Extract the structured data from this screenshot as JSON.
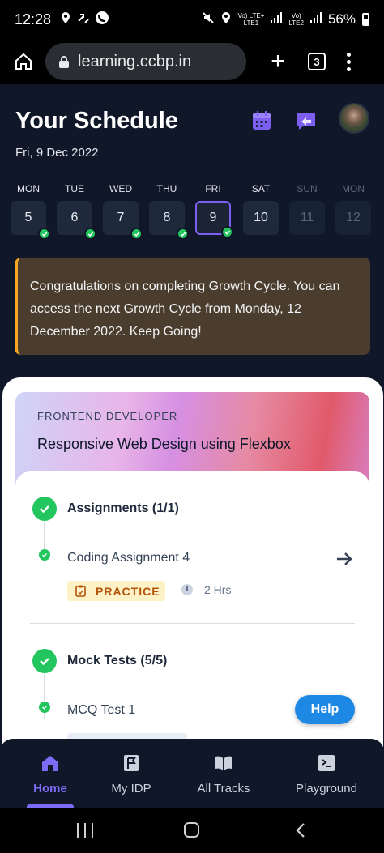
{
  "status_bar": {
    "time": "12:28",
    "net_label_1": "Vo) LTE+",
    "net_label_1b": "LTE1",
    "net_label_2": "Vo)",
    "net_label_2b": "LTE2",
    "battery": "56%"
  },
  "browser": {
    "url": "learning.ccbp.in",
    "tab_count": "3"
  },
  "header": {
    "title": "Your Schedule",
    "date": "Fri, 9 Dec 2022"
  },
  "week": [
    {
      "name": "MON",
      "num": "5",
      "done": true,
      "active": false,
      "dim": false
    },
    {
      "name": "TUE",
      "num": "6",
      "done": true,
      "active": false,
      "dim": false
    },
    {
      "name": "WED",
      "num": "7",
      "done": true,
      "active": false,
      "dim": false
    },
    {
      "name": "THU",
      "num": "8",
      "done": true,
      "active": false,
      "dim": false
    },
    {
      "name": "FRI",
      "num": "9",
      "done": true,
      "active": true,
      "dim": false
    },
    {
      "name": "SAT",
      "num": "10",
      "done": false,
      "active": false,
      "dim": false
    },
    {
      "name": "SUN",
      "num": "11",
      "done": false,
      "active": false,
      "dim": true
    },
    {
      "name": "MON",
      "num": "12",
      "done": false,
      "active": false,
      "dim": true
    }
  ],
  "banner": {
    "text": "Congratulations on completing Growth Cycle. You can access the next Growth Cycle from Monday, 12 December 2022. Keep Going!"
  },
  "course": {
    "track": "FRONTEND DEVELOPER",
    "title": "Responsive Web Design using Flexbox"
  },
  "sections": {
    "assignments": {
      "title": "Assignments (1/1)",
      "item_title": "Coding Assignment 4",
      "badge": "PRACTICE",
      "duration": "2 Hrs"
    },
    "mock_tests": {
      "title": "Mock Tests (5/5)",
      "item_title": "MCQ Test 1"
    }
  },
  "help": {
    "label": "Help"
  },
  "bottom_nav": {
    "home": "Home",
    "my_idp": "My IDP",
    "all_tracks": "All Tracks",
    "playground": "Playground"
  },
  "colors": {
    "accent": "#7c6cf5",
    "success": "#22c55e",
    "banner_border": "#f5a524",
    "help_button": "#1e88e5"
  }
}
